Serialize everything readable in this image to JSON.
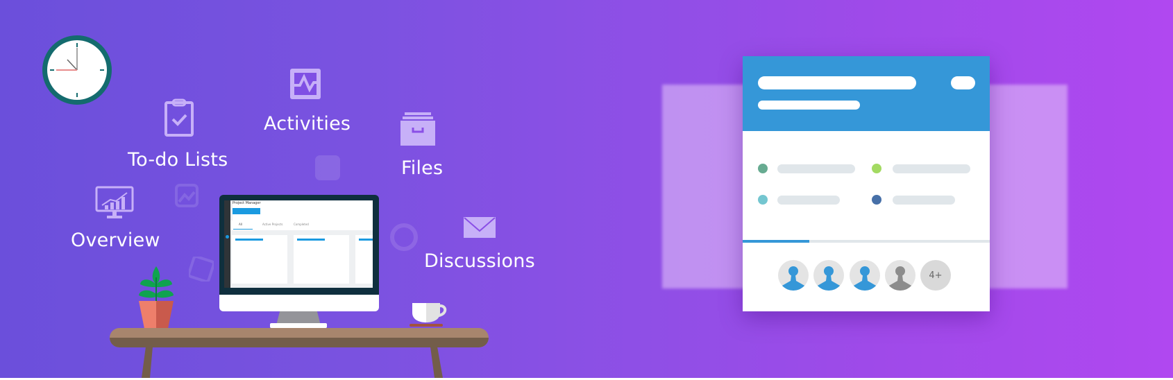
{
  "banner": {
    "background_gradient": [
      "#6b4fdb",
      "#b048f0"
    ],
    "features": [
      {
        "label": "To-do Lists",
        "icon": "clipboard-check-icon"
      },
      {
        "label": "Activities",
        "icon": "activity-chart-icon"
      },
      {
        "label": "Files",
        "icon": "file-drawer-icon"
      },
      {
        "label": "Overview",
        "icon": "monitor-chart-icon"
      },
      {
        "label": "Discussions",
        "icon": "envelope-icon"
      }
    ],
    "label_color": "#ffffff",
    "icon_color": "#c7b0f8"
  },
  "monitor_screen": {
    "title": "Project Manager",
    "tabs": [
      {
        "label": "All"
      },
      {
        "label": "Active Projects"
      },
      {
        "label": "Completed"
      }
    ],
    "accent": "#1a9ae0"
  },
  "project_card": {
    "header_color": "#3597d8",
    "status_dots": [
      "#67ab91",
      "#a3da62",
      "#74c6d0",
      "#4770a8"
    ],
    "progress": 0.27,
    "progress_color": "#3597d8",
    "member_avatars": 4,
    "more_members_label": "4+"
  },
  "clock": {
    "ring_color": "#146b6e",
    "hour_hand_color": "#e88c8c"
  }
}
